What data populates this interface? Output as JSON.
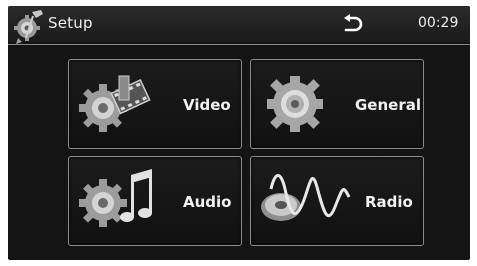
{
  "header": {
    "title": "Setup",
    "time": "00:29",
    "icons": {
      "app": "setup-tools-icon",
      "back": "back-arrow-icon"
    }
  },
  "menu": {
    "items": [
      {
        "label": "Video",
        "icon": "video-gear-icon"
      },
      {
        "label": "General",
        "icon": "general-gear-icon"
      },
      {
        "label": "Audio",
        "icon": "audio-gear-icon"
      },
      {
        "label": "Radio",
        "icon": "radio-wave-icon"
      }
    ]
  }
}
